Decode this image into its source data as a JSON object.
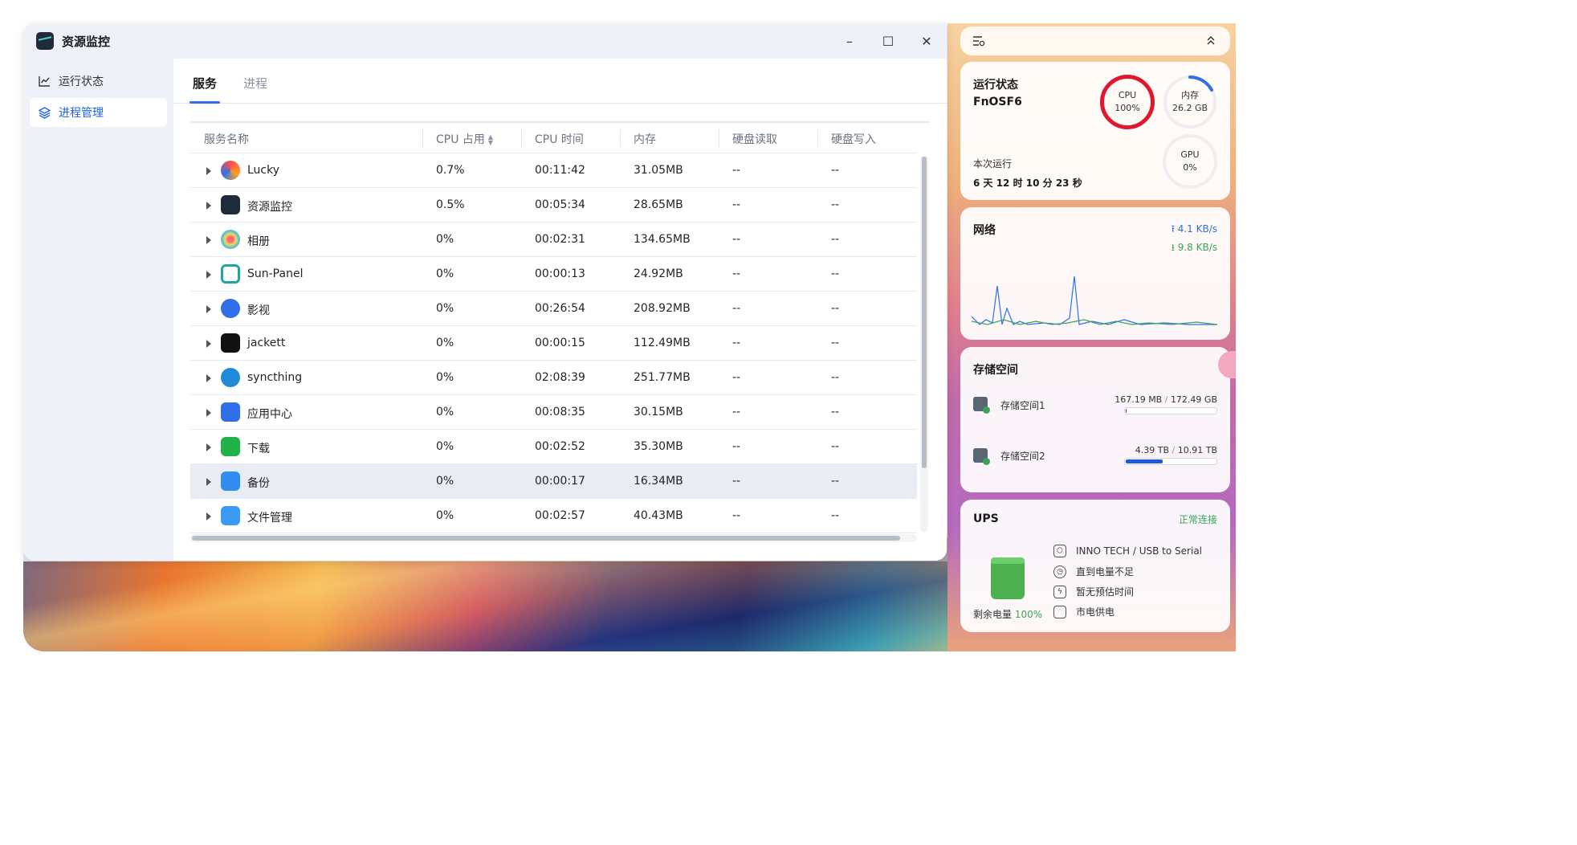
{
  "window": {
    "title": "资源监控",
    "controls": {
      "minimize": "–",
      "maximize": "☐",
      "close": "✕"
    }
  },
  "sidebar": {
    "items": [
      {
        "label": "运行状态",
        "icon": "line-chart-icon",
        "active": false
      },
      {
        "label": "进程管理",
        "icon": "layers-icon",
        "active": true
      }
    ]
  },
  "tabs": [
    {
      "label": "服务",
      "active": true
    },
    {
      "label": "进程",
      "active": false
    }
  ],
  "table": {
    "columns": [
      "服务名称",
      "CPU 占用",
      "CPU 时间",
      "内存",
      "硬盘读取",
      "硬盘写入"
    ],
    "sorted_column": "CPU 占用",
    "rows": [
      {
        "name": "Lucky",
        "cpu": "0.7%",
        "time": "00:11:42",
        "mem": "31.05MB",
        "read": "--",
        "write": "--",
        "icon": "lucky-icon"
      },
      {
        "name": "资源监控",
        "cpu": "0.5%",
        "time": "00:05:34",
        "mem": "28.65MB",
        "read": "--",
        "write": "--",
        "icon": "resource-monitor-icon"
      },
      {
        "name": "相册",
        "cpu": "0%",
        "time": "00:02:31",
        "mem": "134.65MB",
        "read": "--",
        "write": "--",
        "icon": "photos-icon"
      },
      {
        "name": "Sun-Panel",
        "cpu": "0%",
        "time": "00:00:13",
        "mem": "24.92MB",
        "read": "--",
        "write": "--",
        "icon": "sun-panel-icon"
      },
      {
        "name": "影视",
        "cpu": "0%",
        "time": "00:26:54",
        "mem": "208.92MB",
        "read": "--",
        "write": "--",
        "icon": "video-icon"
      },
      {
        "name": "jackett",
        "cpu": "0%",
        "time": "00:00:15",
        "mem": "112.49MB",
        "read": "--",
        "write": "--",
        "icon": "jackett-icon"
      },
      {
        "name": "syncthing",
        "cpu": "0%",
        "time": "02:08:39",
        "mem": "251.77MB",
        "read": "--",
        "write": "--",
        "icon": "syncthing-icon"
      },
      {
        "name": "应用中心",
        "cpu": "0%",
        "time": "00:08:35",
        "mem": "30.15MB",
        "read": "--",
        "write": "--",
        "icon": "app-store-icon"
      },
      {
        "name": "下载",
        "cpu": "0%",
        "time": "00:02:52",
        "mem": "35.30MB",
        "read": "--",
        "write": "--",
        "icon": "download-icon"
      },
      {
        "name": "备份",
        "cpu": "0%",
        "time": "00:00:17",
        "mem": "16.34MB",
        "read": "--",
        "write": "--",
        "icon": "backup-icon",
        "selected": true
      },
      {
        "name": "文件管理",
        "cpu": "0%",
        "time": "00:02:57",
        "mem": "40.43MB",
        "read": "--",
        "write": "--",
        "icon": "file-manager-icon"
      }
    ]
  },
  "widgets": {
    "status": {
      "title": "运行状态",
      "host": "FnOSF6",
      "uptime_label": "本次运行",
      "uptime": "6 天 12 时 10 分 23 秒",
      "cpu": {
        "label": "CPU",
        "value": "100%",
        "fraction": 1.0,
        "color": "#e0182d"
      },
      "mem": {
        "label": "内存",
        "value": "26.2 GB",
        "fraction": 0.17,
        "color": "#2f6fe8"
      },
      "gpu": {
        "label": "GPU",
        "value": "0%",
        "fraction": 0
      }
    },
    "network": {
      "title": "网络",
      "up": "4.1 KB/s",
      "down": "9.8 KB/s",
      "up_color": "#2f6fe8",
      "down_color": "#3aa55a"
    },
    "storage": {
      "title": "存储空间",
      "volumes": [
        {
          "name": "存储空间1",
          "used": "167.19 MB",
          "total": "172.49 GB",
          "fraction": 0.001
        },
        {
          "name": "存储空间2",
          "used": "4.39 TB",
          "total": "10.91 TB",
          "fraction": 0.4
        }
      ]
    },
    "ups": {
      "title": "UPS",
      "status": "正常连接",
      "remaining_label": "剩余电量",
      "remaining": "100%",
      "lines": [
        "INNO TECH / USB to Serial",
        "直到电量不足",
        "暂无预估时间",
        "市电供电"
      ]
    }
  }
}
